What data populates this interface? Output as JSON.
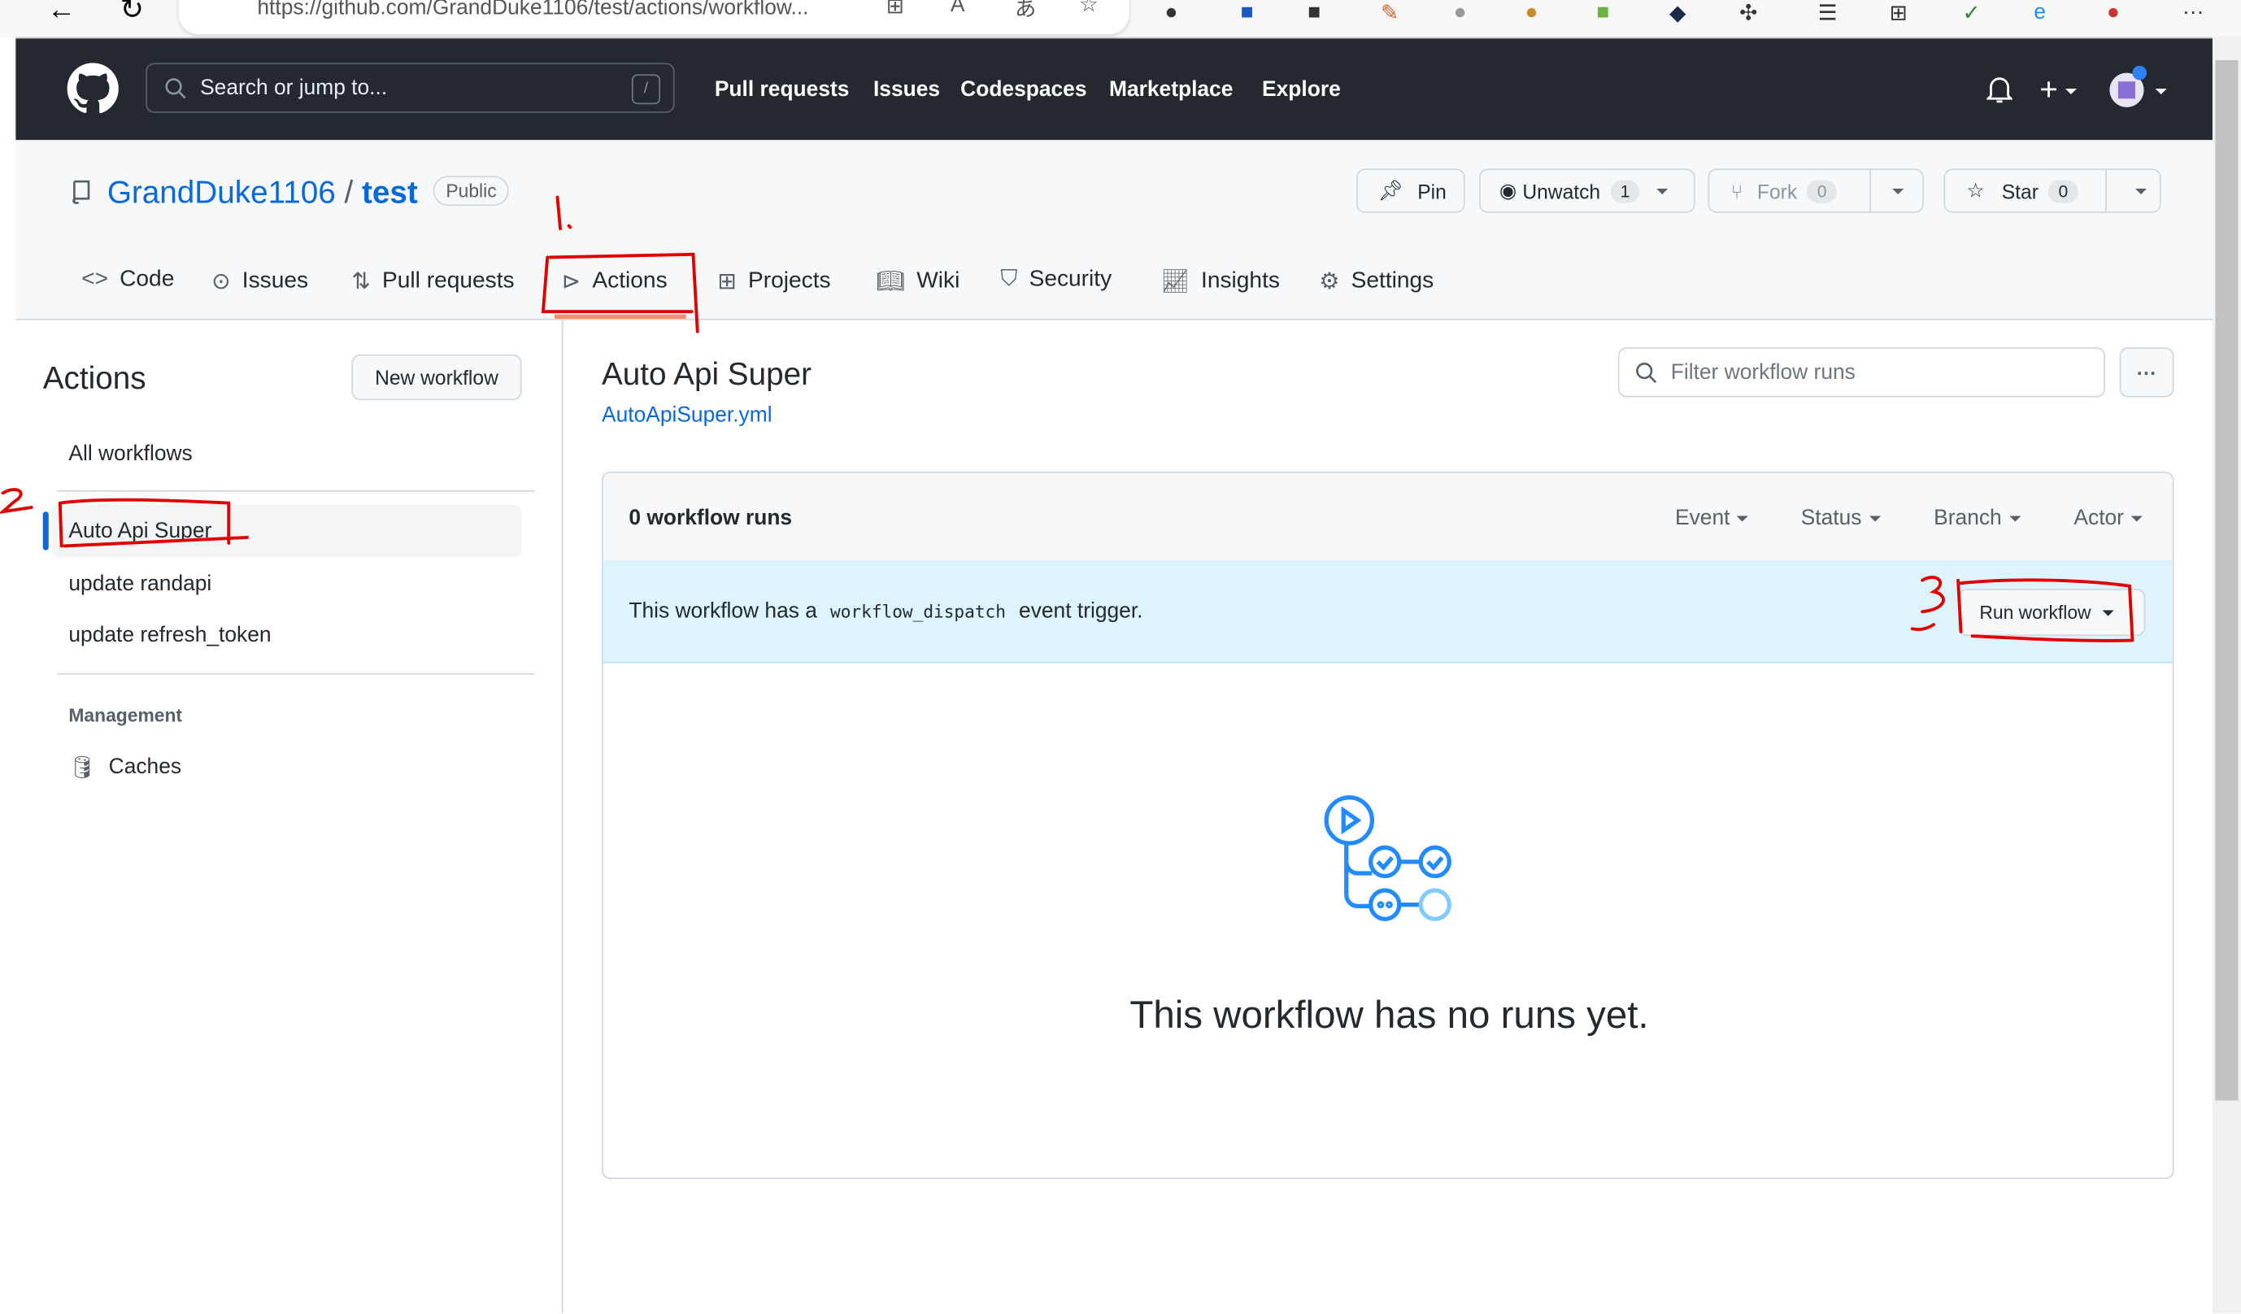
{
  "browser": {
    "url": "https://github.com/GrandDuke1106/test/actions/workflow..."
  },
  "header": {
    "search_placeholder": "Search or jump to...",
    "search_shortcut": "/",
    "nav": [
      "Pull requests",
      "Issues",
      "Codespaces",
      "Marketplace",
      "Explore"
    ]
  },
  "repo": {
    "owner": "GrandDuke1106",
    "separator": "/",
    "name": "test",
    "visibility": "Public",
    "pin": "Pin",
    "unwatch": "Unwatch",
    "watch_count": "1",
    "fork": "Fork",
    "fork_count": "0",
    "star": "Star",
    "star_count": "0"
  },
  "tabs": [
    "Code",
    "Issues",
    "Pull requests",
    "Actions",
    "Projects",
    "Wiki",
    "Security",
    "Insights",
    "Settings"
  ],
  "sidebar": {
    "title": "Actions",
    "new_workflow": "New workflow",
    "all_workflows": "All workflows",
    "workflows": [
      "Auto Api Super",
      "update randapi",
      "update refresh_token"
    ],
    "management": "Management",
    "caches": "Caches"
  },
  "main": {
    "title": "Auto Api Super",
    "file": "AutoApiSuper.yml",
    "filter_placeholder": "Filter workflow runs",
    "runs_count": "0 workflow runs",
    "filters": [
      "Event",
      "Status",
      "Branch",
      "Actor"
    ],
    "banner_pre": "This workflow has a",
    "banner_code": "workflow_dispatch",
    "banner_post": "event trigger.",
    "run_workflow": "Run workflow",
    "empty": "This workflow has no runs yet."
  },
  "annotations": {
    "a1": "1.",
    "a2": "2",
    "a3": "3"
  },
  "colors": {
    "header_bg": "#24292f",
    "link": "#0969da",
    "banner": "#ddf4ff",
    "annotation": "#e00000"
  }
}
